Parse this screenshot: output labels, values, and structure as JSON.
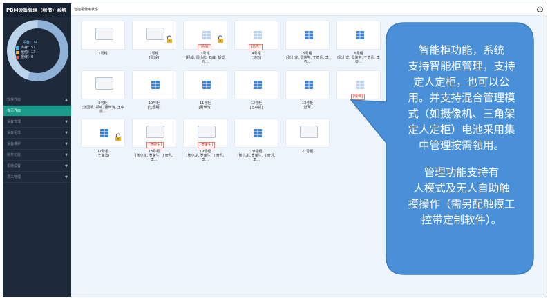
{
  "app": {
    "title": "PBM设备管理（租借）系统",
    "breadcrumb": "智能柜使用状态"
  },
  "stats": {
    "total_label": "设备：",
    "total_value": "14",
    "items": [
      {
        "label": "库存：",
        "value": "51",
        "color": "#3db6e8"
      },
      {
        "label": "租借：",
        "value": "13",
        "color": "#e9b64a"
      },
      {
        "label": "报修：",
        "value": "0",
        "color": "#e0574f"
      }
    ],
    "donut_colors": [
      "#8fb1d8",
      "#bcd3ec"
    ]
  },
  "menu": {
    "items": [
      {
        "label": "软件界面",
        "chevron": "▲"
      },
      {
        "label": "首页界面",
        "chevron": ""
      },
      {
        "label": "设备管理",
        "chevron": "▼"
      },
      {
        "label": "设备租借",
        "chevron": "▼"
      },
      {
        "label": "设备维护",
        "chevron": "▼"
      },
      {
        "label": "财务功能",
        "chevron": "▼"
      },
      {
        "label": "系统设置",
        "chevron": "▼"
      },
      {
        "label": "员工管理",
        "chevron": "▼"
      }
    ]
  },
  "cabinets": [
    {
      "label": "1号柜",
      "users": ""
    },
    {
      "label": "2号柜",
      "users": "[张毅]"
    },
    {
      "label": "3号柜",
      "users": "[杨浦, 周小松, 石峰, 胡贺光…"
    },
    {
      "label": "4号柜",
      "users": "[马杰]"
    },
    {
      "label": "5号柜",
      "users": "[张小龙, 罗荣生, 丁奇凡, 李亦…"
    },
    {
      "label": "6号柜",
      "users": "[张小龙, 罗荣生, 丁奇凡, 李亦…"
    },
    {
      "label": "9号柜",
      "users": "[沈国明, 郑威, 董世涛, 王中凯…"
    },
    {
      "label": "10号柜",
      "users": "[沈国明]"
    },
    {
      "label": "11号柜",
      "users": "[董世涛]"
    },
    {
      "label": "12号柜",
      "users": "[王中凯]"
    },
    {
      "label": "13号柜",
      "users": "[陆军]"
    },
    {
      "label": "14号柜",
      "users": "[徐伟]"
    },
    {
      "label": "17号柜",
      "users": "[王海滨]"
    },
    {
      "label": "18号柜",
      "users": "[张小龙, 罗荣生, 丁奇凡, 李…"
    },
    {
      "label": "19号柜",
      "users": "[张小龙, 罗荣生, 丁奇凡, 李…"
    },
    {
      "label": "20号柜",
      "users": "[张小龙, 罗荣生, 丁奇凡, 李…"
    },
    {
      "label": "21号柜",
      "users": ""
    }
  ],
  "tags": {
    "t3": "[杨浦]",
    "t4": "[马杰]",
    "t14": "[徐伟]",
    "t18": "[罗荣生]",
    "t19": "[罗荣生]"
  },
  "callout": {
    "para1_lines": [
      "智能柜功能，系统",
      "支持智能柜管理，支持",
      "定人定柜，也可以公",
      "用。并支持混合管理模",
      "式（如摄像机、三角架",
      "定人定柜）电池采用集",
      "中管理按需领用。"
    ],
    "para2_lines": [
      "管理功能支持有",
      "人模式及无人自助触",
      "摸操作（需另配触摸工",
      "控带定制软件）。"
    ],
    "fill_color": "#4a90d9",
    "stroke_color": "#3a7bc0"
  }
}
